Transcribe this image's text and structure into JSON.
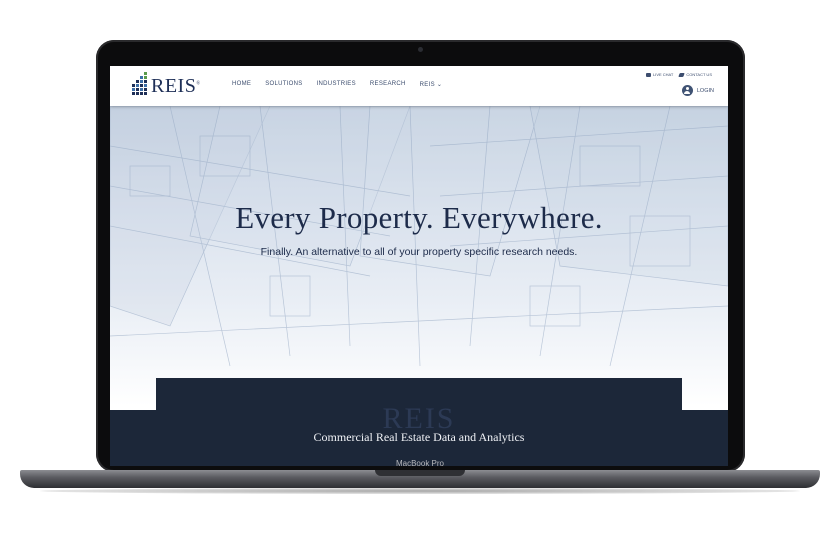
{
  "device": {
    "label": "MacBook Pro"
  },
  "brand": {
    "logo_text": "REIS",
    "trademark": "®"
  },
  "nav": {
    "items": [
      {
        "label": "HOME"
      },
      {
        "label": "SOLUTIONS"
      },
      {
        "label": "INDUSTRIES"
      },
      {
        "label": "RESEARCH"
      },
      {
        "label": "REIS ⌄"
      }
    ],
    "util": {
      "live_chat": "LIVE CHAT",
      "contact_us": "CONTACT US"
    },
    "login": "LOGIN"
  },
  "hero": {
    "title": "Every Property. Everywhere.",
    "subtitle": "Finally. An alternative to all of your property specific research needs."
  },
  "band": {
    "watermark": "REIS",
    "text": "Commercial Real Estate Data and Analytics"
  },
  "colors": {
    "navy": "#1c2739",
    "brand": "#1e2f57",
    "accent_green": "#5a9b4b"
  },
  "icons": [
    "logo-mark-icon",
    "chat-icon",
    "send-icon",
    "user-icon",
    "chevron-down-icon"
  ]
}
